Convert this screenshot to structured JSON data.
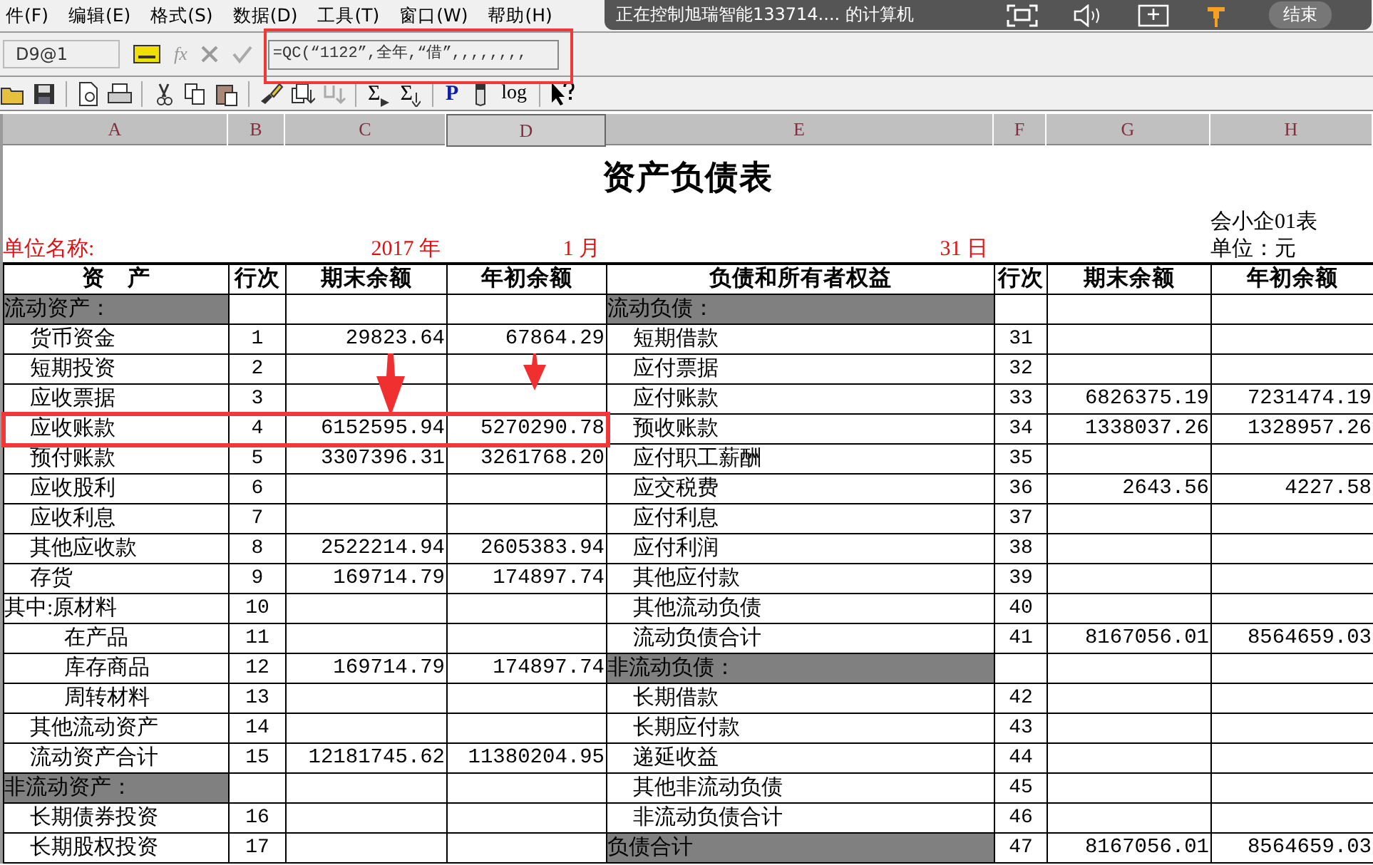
{
  "remote_bar": {
    "text": "正在控制旭瑞智能133714.... 的计算机",
    "end_button": "结束"
  },
  "menu": [
    "件(F)",
    "编辑(E)",
    "格式(S)",
    "数据(D)",
    "工具(T)",
    "窗口(W)",
    "帮助(H)"
  ],
  "formula_bar": {
    "cell_ref": "D9@1",
    "fx": "fx",
    "formula": "=QC(“1122”,全年,“借”,,,,,,,,"
  },
  "toolbar": [
    {
      "kind": "open"
    },
    {
      "kind": "save"
    },
    {
      "kind": "sep"
    },
    {
      "kind": "preview"
    },
    {
      "kind": "print"
    },
    {
      "kind": "sep"
    },
    {
      "kind": "cut"
    },
    {
      "kind": "copy"
    },
    {
      "kind": "paste"
    },
    {
      "kind": "sep"
    },
    {
      "kind": "brush"
    },
    {
      "kind": "fill"
    },
    {
      "kind": "fill-disabled"
    },
    {
      "kind": "sep"
    },
    {
      "kind": "sum",
      "label": "Σ"
    },
    {
      "kind": "sum-down",
      "label": "Σ"
    },
    {
      "kind": "sep"
    },
    {
      "kind": "letter",
      "label": "P"
    },
    {
      "kind": "pen"
    },
    {
      "kind": "letter-plain",
      "label": "log"
    },
    {
      "kind": "sep"
    },
    {
      "kind": "help"
    }
  ],
  "columns": [
    {
      "label": "A",
      "selected": false
    },
    {
      "label": "B",
      "selected": false
    },
    {
      "label": "C",
      "selected": false
    },
    {
      "label": "D",
      "selected": true
    },
    {
      "label": "E",
      "selected": false
    },
    {
      "label": "F",
      "selected": false
    },
    {
      "label": "G",
      "selected": false
    },
    {
      "label": "H",
      "selected": false
    }
  ],
  "sheet": {
    "title": "资产负债表",
    "form_code": "会小企01表",
    "unit_name_label": "单位名称:",
    "year": "2017 年",
    "month": "1 月",
    "day": "31 日",
    "currency": "单位：元",
    "header": [
      "资　产",
      "行次",
      "期末余额",
      "年初余额",
      "负债和所有者权益",
      "行次",
      "期末余额",
      "年初余额"
    ],
    "rows": [
      {
        "highlighted": false,
        "left": {
          "kind": "section",
          "label": "流动资产："
        },
        "right": {
          "kind": "section",
          "label": "流动负债："
        }
      },
      {
        "highlighted": false,
        "left": {
          "kind": "item",
          "label": "货币资金",
          "line": "1",
          "end": "29823.64",
          "begin": "67864.29"
        },
        "right": {
          "kind": "item",
          "label": "短期借款",
          "line": "31"
        }
      },
      {
        "highlighted": false,
        "left": {
          "kind": "item",
          "label": "短期投资",
          "line": "2"
        },
        "right": {
          "kind": "item",
          "label": "应付票据",
          "line": "32"
        }
      },
      {
        "highlighted": false,
        "left": {
          "kind": "item",
          "label": "应收票据",
          "line": "3"
        },
        "right": {
          "kind": "item",
          "label": "应付账款",
          "line": "33",
          "end": "6826375.19",
          "begin": "7231474.19"
        }
      },
      {
        "highlighted": true,
        "left": {
          "kind": "item",
          "label": "应收账款",
          "line": "4",
          "end": "6152595.94",
          "begin": "5270290.78"
        },
        "right": {
          "kind": "item",
          "label": "预收账款",
          "line": "34",
          "end": "1338037.26",
          "begin": "1328957.26"
        }
      },
      {
        "highlighted": false,
        "left": {
          "kind": "item",
          "label": "预付账款",
          "line": "5",
          "end": "3307396.31",
          "begin": "3261768.20"
        },
        "right": {
          "kind": "item",
          "label": "应付职工薪酬",
          "line": "35"
        }
      },
      {
        "highlighted": false,
        "left": {
          "kind": "item",
          "label": "应收股利",
          "line": "6"
        },
        "right": {
          "kind": "item",
          "label": "应交税费",
          "line": "36",
          "end": "2643.56",
          "begin": "4227.58"
        }
      },
      {
        "highlighted": false,
        "left": {
          "kind": "item",
          "label": "应收利息",
          "line": "7"
        },
        "right": {
          "kind": "item",
          "label": "应付利息",
          "line": "37"
        }
      },
      {
        "highlighted": false,
        "left": {
          "kind": "item",
          "label": "其他应收款",
          "line": "8",
          "end": "2522214.94",
          "begin": "2605383.94"
        },
        "right": {
          "kind": "item",
          "label": "应付利润",
          "line": "38"
        }
      },
      {
        "highlighted": false,
        "left": {
          "kind": "item",
          "label": "存货",
          "line": "9",
          "end": "169714.79",
          "begin": "174897.74"
        },
        "right": {
          "kind": "item",
          "label": "其他应付款",
          "line": "39"
        }
      },
      {
        "highlighted": false,
        "left": {
          "kind": "plain",
          "label": "其中:原材料",
          "line": "10"
        },
        "right": {
          "kind": "item",
          "label": "其他流动负债",
          "line": "40"
        }
      },
      {
        "highlighted": false,
        "left": {
          "kind": "sub",
          "label": "在产品",
          "line": "11"
        },
        "right": {
          "kind": "item",
          "label": "流动负债合计",
          "line": "41",
          "end": "8167056.01",
          "begin": "8564659.03"
        }
      },
      {
        "highlighted": false,
        "left": {
          "kind": "sub",
          "label": "库存商品",
          "line": "12",
          "end": "169714.79",
          "begin": "174897.74"
        },
        "right": {
          "kind": "section",
          "label": "非流动负债："
        }
      },
      {
        "highlighted": false,
        "left": {
          "kind": "sub",
          "label": "周转材料",
          "line": "13"
        },
        "right": {
          "kind": "item",
          "label": "长期借款",
          "line": "42"
        }
      },
      {
        "highlighted": false,
        "left": {
          "kind": "item",
          "label": "其他流动资产",
          "line": "14"
        },
        "right": {
          "kind": "item",
          "label": "长期应付款",
          "line": "43"
        }
      },
      {
        "highlighted": false,
        "left": {
          "kind": "item",
          "label": "流动资产合计",
          "line": "15",
          "end": "12181745.62",
          "begin": "11380204.95"
        },
        "right": {
          "kind": "item",
          "label": "递延收益",
          "line": "44"
        }
      },
      {
        "highlighted": false,
        "left": {
          "kind": "section",
          "label": "非流动资产："
        },
        "right": {
          "kind": "item",
          "label": "其他非流动负债",
          "line": "45"
        }
      },
      {
        "highlighted": false,
        "left": {
          "kind": "item",
          "label": "长期债券投资",
          "line": "16"
        },
        "right": {
          "kind": "item",
          "label": "非流动负债合计",
          "line": "46"
        }
      },
      {
        "highlighted": false,
        "left": {
          "kind": "item",
          "label": "长期股权投资",
          "line": "17"
        },
        "right": {
          "kind": "section",
          "label": "负债合计",
          "line": "47",
          "end": "8167056.01",
          "begin": "8564659.03"
        }
      }
    ]
  }
}
